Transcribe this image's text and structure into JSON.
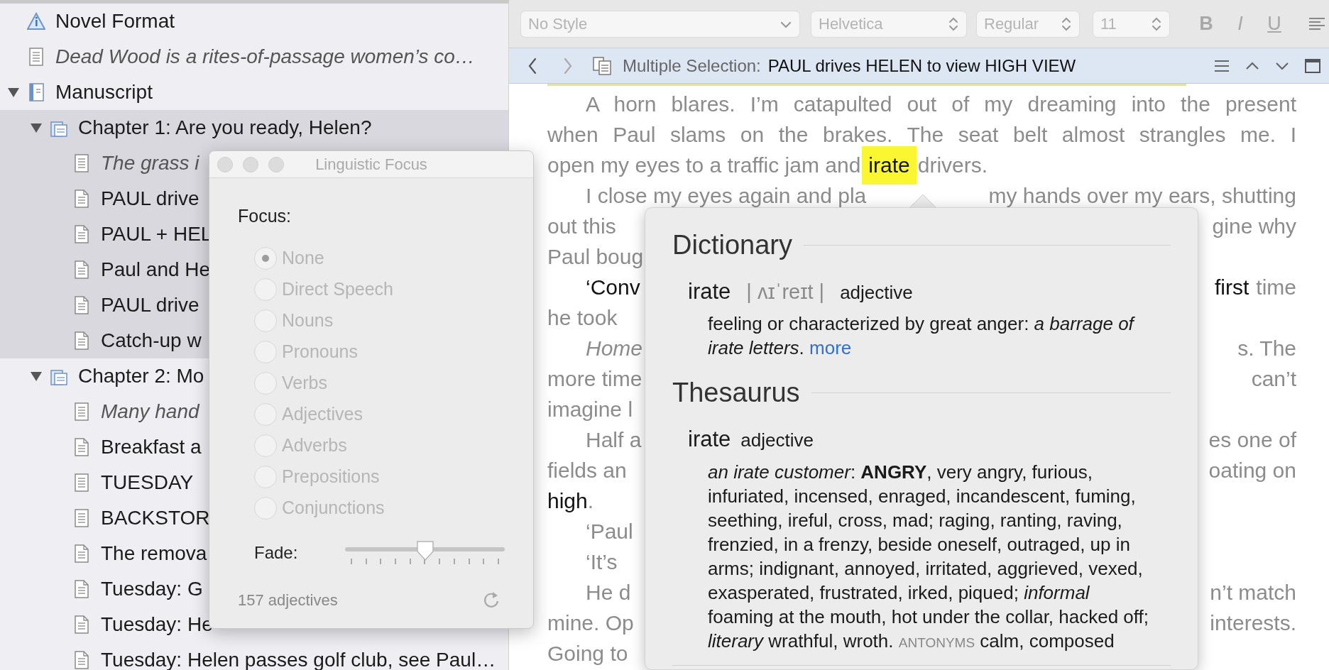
{
  "sidebar": {
    "items": [
      {
        "label": "Novel Format",
        "kind": "info",
        "italic": false,
        "selected": false
      },
      {
        "label": "Dead Wood is a rites-of-passage women’s co…",
        "kind": "note",
        "italic": true,
        "selected": false
      },
      {
        "label": "Manuscript",
        "kind": "book",
        "italic": false,
        "selected": false,
        "expanded": true,
        "children": [
          {
            "label": "Chapter 1: Are you ready, Helen?",
            "kind": "folder",
            "italic": false,
            "selected": true,
            "expanded": true,
            "children": [
              {
                "label": "The grass i",
                "kind": "note",
                "italic": true,
                "selected": true
              },
              {
                "label": "PAUL drive",
                "kind": "page",
                "italic": false,
                "selected": true
              },
              {
                "label": "PAUL + HEL",
                "kind": "page",
                "italic": false,
                "selected": true
              },
              {
                "label": "Paul and He",
                "kind": "page",
                "italic": false,
                "selected": true
              },
              {
                "label": "PAUL drive",
                "kind": "page",
                "italic": false,
                "selected": true
              },
              {
                "label": "Catch-up w",
                "kind": "page",
                "italic": false,
                "selected": true
              }
            ]
          },
          {
            "label": "Chapter 2: Mo",
            "kind": "folder",
            "italic": false,
            "selected": false,
            "expanded": true,
            "children": [
              {
                "label": "Many hand",
                "kind": "note",
                "italic": true,
                "selected": false
              },
              {
                "label": "Breakfast a",
                "kind": "page",
                "italic": false,
                "selected": false
              },
              {
                "label": "TUESDAY",
                "kind": "note",
                "italic": false,
                "selected": false
              },
              {
                "label": "BACKSTOR",
                "kind": "note",
                "italic": false,
                "selected": false
              },
              {
                "label": "The remova",
                "kind": "page",
                "italic": false,
                "selected": false
              },
              {
                "label": "Tuesday: G",
                "kind": "page",
                "italic": false,
                "selected": false
              },
              {
                "label": "Tuesday: He",
                "kind": "page",
                "italic": false,
                "selected": false
              },
              {
                "label": "Tuesday: Helen passes golf club, see Paul…",
                "kind": "page",
                "italic": false,
                "selected": false
              }
            ]
          }
        ]
      }
    ]
  },
  "toolbar": {
    "style": {
      "value": "No Style",
      "disabled": true
    },
    "font": {
      "value": "Helvetica",
      "disabled": true
    },
    "typeface": {
      "value": "Regular",
      "disabled": true
    },
    "size": {
      "value": "11",
      "disabled": true
    },
    "format_buttons": [
      {
        "label": "B",
        "disabled": true
      },
      {
        "label": "I",
        "disabled": true
      },
      {
        "label": "U",
        "disabled": true
      }
    ]
  },
  "header": {
    "label": "Multiple Selection:",
    "title": "PAUL drives HELEN to view HIGH VIEW"
  },
  "editor": {
    "lines": [
      {
        "kind": "first",
        "justified": true,
        "left": [
          {
            "text": "A horn blares. I’m catapulted out of my dreaming into the present",
            "focus": false
          }
        ]
      },
      {
        "kind": "wrap",
        "justified": true,
        "left": [
          {
            "text": "when Paul slams on the brakes. The seat belt almost strangles me. I",
            "focus": false
          }
        ]
      },
      {
        "kind": "wrap",
        "justified": false,
        "left": [
          {
            "text": "open my eyes to a traffic jam and",
            "focus": false
          },
          {
            "text": "irate",
            "focus": true,
            "highlighted": true
          },
          {
            "text": "drivers.",
            "focus": false
          }
        ]
      },
      {
        "kind": "first",
        "justified": false,
        "left": [
          {
            "text": "I close my eyes again and pla",
            "focus": false
          }
        ],
        "right": [
          {
            "text": "my hands over my ears, shutting",
            "focus": false
          }
        ]
      },
      {
        "kind": "wrap",
        "justified": false,
        "left": [
          {
            "text": "out this",
            "focus": false
          }
        ],
        "right": [
          {
            "text": "gine why",
            "focus": false
          }
        ]
      },
      {
        "kind": "wrap",
        "justified": false,
        "left": [
          {
            "text": "Paul boug",
            "focus": false
          }
        ]
      },
      {
        "kind": "first",
        "justified": false,
        "left": [
          {
            "text": "‘Conv",
            "focus": true
          }
        ],
        "right": [
          {
            "text": "first",
            "focus": true
          },
          {
            "text": "time",
            "focus": false
          }
        ]
      },
      {
        "kind": "wrap",
        "justified": false,
        "left": [
          {
            "text": "he took",
            "focus": false
          }
        ]
      },
      {
        "kind": "first",
        "justified": false,
        "left": [
          {
            "text": "Home",
            "focus": false,
            "italic": true
          }
        ],
        "right": [
          {
            "text": "s. The",
            "focus": false
          }
        ]
      },
      {
        "kind": "wrap",
        "justified": false,
        "left": [
          {
            "text": "more time",
            "focus": false
          }
        ],
        "right": [
          {
            "text": "can’t",
            "focus": false
          }
        ]
      },
      {
        "kind": "wrap",
        "justified": false,
        "left": [
          {
            "text": "imagine l",
            "focus": false
          }
        ]
      },
      {
        "kind": "first",
        "justified": false,
        "left": [
          {
            "text": "Half a",
            "focus": false
          }
        ],
        "right": [
          {
            "text": "es one of",
            "focus": false
          }
        ]
      },
      {
        "kind": "wrap",
        "justified": false,
        "left": [
          {
            "text": "fields an",
            "focus": false
          }
        ],
        "right": [
          {
            "text": "oating on",
            "focus": false
          }
        ]
      },
      {
        "kind": "wrap",
        "justified": false,
        "left": [
          {
            "text": "high",
            "focus": true
          },
          {
            "text": ".",
            "focus": false
          }
        ]
      },
      {
        "kind": "first",
        "justified": false,
        "left": [
          {
            "text": "‘Paul",
            "focus": false
          }
        ]
      },
      {
        "kind": "first",
        "justified": false,
        "left": [
          {
            "text": "‘It’s",
            "focus": false
          }
        ]
      },
      {
        "kind": "first",
        "justified": false,
        "left": [
          {
            "text": "He d",
            "focus": false
          }
        ],
        "right": [
          {
            "text": "n’t match",
            "focus": false
          }
        ]
      },
      {
        "kind": "wrap",
        "justified": false,
        "left": [
          {
            "text": "mine. Op",
            "focus": false
          }
        ],
        "right": [
          {
            "text": "interests.",
            "focus": false
          }
        ]
      },
      {
        "kind": "wrap",
        "justified": false,
        "left": [
          {
            "text": "Going to",
            "focus": false
          }
        ]
      }
    ]
  },
  "lookup": {
    "dictionary": {
      "heading": "Dictionary",
      "word": "irate",
      "pronunciation": "| ʌɪˈreɪt |",
      "part_of_speech": "adjective",
      "definition": "feeling or characterized by great anger: *a barrage of irate letters*.",
      "more_link": "more"
    },
    "thesaurus": {
      "heading": "Thesaurus",
      "word": "irate",
      "part_of_speech": "adjective",
      "synonyms": "*an irate customer*: **ANGRY**, very angry, furious, infuriated, incensed, enraged, incandescent, fuming, seething, ireful, cross, mad; raging, ranting, raving, frenzied, in a frenzy, beside oneself, outraged, up in arms; indignant, annoyed, irritated, aggrieved, vexed, exasperated, frustrated, irked, piqued; *informal* foaming at the mouth, hot under the collar, hacked off; *literary* wrathful, wroth.",
      "antonyms_label": "ANTONYMS",
      "antonyms": "calm, composed"
    }
  },
  "focus_panel": {
    "title": "Linguistic Focus",
    "focus_label": "Focus:",
    "options_disabled": true,
    "options": [
      {
        "label": "None",
        "selected": true
      },
      {
        "label": "Direct Speech",
        "selected": false
      },
      {
        "label": "Nouns",
        "selected": false
      },
      {
        "label": "Pronouns",
        "selected": false
      },
      {
        "label": "Verbs",
        "selected": false
      },
      {
        "label": "Adjectives",
        "selected": false
      },
      {
        "label": "Adverbs",
        "selected": false
      },
      {
        "label": "Prepositions",
        "selected": false
      },
      {
        "label": "Conjunctions",
        "selected": false
      }
    ],
    "fade_label": "Fade:",
    "fade": {
      "level": 0.5
    },
    "count": "157 adjectives"
  }
}
